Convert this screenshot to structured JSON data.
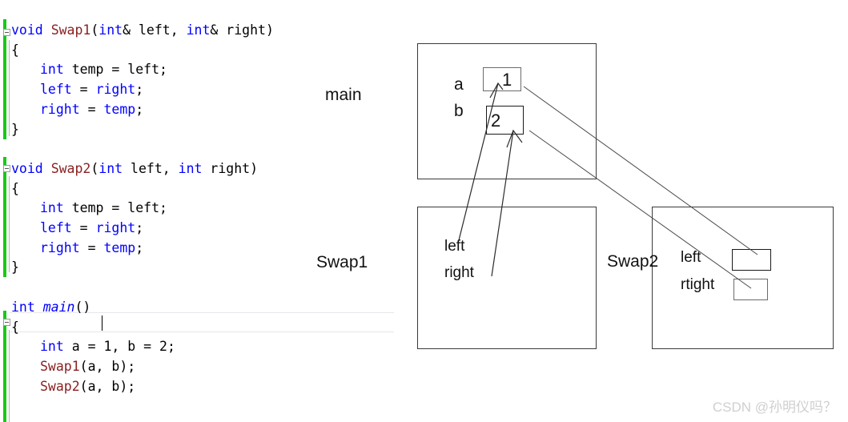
{
  "editor": {
    "language": "cpp",
    "colors": {
      "keyword": "#0000ff",
      "function": "#8b2121",
      "text": "#000000",
      "change_bar": "#19c819",
      "current_line_border": "#e6e6ec"
    },
    "lines": [
      {
        "n": 1,
        "indent": 0,
        "tokens": [
          {
            "t": "void",
            "c": "kw"
          },
          {
            "t": " ",
            "c": "id"
          },
          {
            "t": "Swap1",
            "c": "fn"
          },
          {
            "t": "(",
            "c": "id"
          },
          {
            "t": "int",
            "c": "kw"
          },
          {
            "t": "& left, ",
            "c": "id"
          },
          {
            "t": "int",
            "c": "kw"
          },
          {
            "t": "& right)",
            "c": "id"
          }
        ]
      },
      {
        "n": 2,
        "indent": 0,
        "tokens": [
          {
            "t": "{",
            "c": "id"
          }
        ]
      },
      {
        "n": 3,
        "indent": 1,
        "tokens": [
          {
            "t": "int",
            "c": "kw"
          },
          {
            "t": " temp = left;",
            "c": "id"
          }
        ]
      },
      {
        "n": 4,
        "indent": 1,
        "tokens": [
          {
            "t": "left",
            "c": "kw"
          },
          {
            "t": " = ",
            "c": "id"
          },
          {
            "t": "right",
            "c": "kw"
          },
          {
            "t": ";",
            "c": "id"
          }
        ]
      },
      {
        "n": 5,
        "indent": 1,
        "tokens": [
          {
            "t": "right",
            "c": "kw"
          },
          {
            "t": " = ",
            "c": "id"
          },
          {
            "t": "temp",
            "c": "kw"
          },
          {
            "t": ";",
            "c": "id"
          }
        ]
      },
      {
        "n": 6,
        "indent": 0,
        "tokens": [
          {
            "t": "}",
            "c": "id"
          }
        ]
      },
      {
        "n": 7,
        "indent": 0,
        "tokens": [
          {
            "t": "",
            "c": "id"
          }
        ]
      },
      {
        "n": 8,
        "indent": 0,
        "tokens": [
          {
            "t": "void",
            "c": "kw"
          },
          {
            "t": " ",
            "c": "id"
          },
          {
            "t": "Swap2",
            "c": "fn"
          },
          {
            "t": "(",
            "c": "id"
          },
          {
            "t": "int",
            "c": "kw"
          },
          {
            "t": " left, ",
            "c": "id"
          },
          {
            "t": "int",
            "c": "kw"
          },
          {
            "t": " right)",
            "c": "id"
          }
        ]
      },
      {
        "n": 9,
        "indent": 0,
        "tokens": [
          {
            "t": "{",
            "c": "id"
          }
        ]
      },
      {
        "n": 10,
        "indent": 1,
        "tokens": [
          {
            "t": "int",
            "c": "kw"
          },
          {
            "t": " temp = left;",
            "c": "id"
          }
        ]
      },
      {
        "n": 11,
        "indent": 1,
        "tokens": [
          {
            "t": "left",
            "c": "kw"
          },
          {
            "t": " = ",
            "c": "id"
          },
          {
            "t": "right",
            "c": "kw"
          },
          {
            "t": ";",
            "c": "id"
          }
        ]
      },
      {
        "n": 12,
        "indent": 1,
        "tokens": [
          {
            "t": "right",
            "c": "kw"
          },
          {
            "t": " = ",
            "c": "id"
          },
          {
            "t": "temp",
            "c": "kw"
          },
          {
            "t": ";",
            "c": "id"
          }
        ]
      },
      {
        "n": 13,
        "indent": 0,
        "tokens": [
          {
            "t": "}",
            "c": "id"
          }
        ]
      },
      {
        "n": 14,
        "indent": 0,
        "tokens": [
          {
            "t": "",
            "c": "id"
          }
        ]
      },
      {
        "n": 15,
        "indent": 0,
        "tokens": [
          {
            "t": "int",
            "c": "kw"
          },
          {
            "t": " ",
            "c": "id"
          },
          {
            "t": "main",
            "c": "kw-it"
          },
          {
            "t": "()",
            "c": "id"
          }
        ]
      },
      {
        "n": 16,
        "indent": 0,
        "tokens": [
          {
            "t": "{",
            "c": "id"
          }
        ]
      },
      {
        "n": 17,
        "indent": 1,
        "tokens": [
          {
            "t": "int",
            "c": "kw"
          },
          {
            "t": " a = 1, b = 2;",
            "c": "id"
          }
        ]
      },
      {
        "n": 18,
        "indent": 1,
        "tokens": [
          {
            "t": "Swap1",
            "c": "fn"
          },
          {
            "t": "(a, b);",
            "c": "id"
          }
        ]
      },
      {
        "n": 19,
        "indent": 1,
        "tokens": [
          {
            "t": "Swap2",
            "c": "fn"
          },
          {
            "t": "(a, b);",
            "c": "id"
          }
        ]
      }
    ],
    "current_line": 15,
    "collapse_markers": [
      "Swap1",
      "Swap2",
      "main"
    ]
  },
  "diagram": {
    "frames": [
      {
        "id": "main",
        "label": "main"
      },
      {
        "id": "swap1",
        "label": "Swap1"
      },
      {
        "id": "swap2",
        "label": "Swap2"
      }
    ],
    "main_frame": {
      "label": "main",
      "variables": [
        {
          "name": "a",
          "value": "1"
        },
        {
          "name": "b",
          "value": "2"
        }
      ]
    },
    "swap1_frame": {
      "label": "Swap1",
      "variables": [
        {
          "name": "left",
          "value": ""
        },
        {
          "name": "right",
          "value": ""
        }
      ]
    },
    "swap2_frame": {
      "label": "Swap2",
      "variables": [
        {
          "name": "left",
          "value": ""
        },
        {
          "name": "rtight",
          "value": ""
        }
      ]
    }
  },
  "watermark": {
    "text": "CSDN @孙明仪吗？"
  }
}
